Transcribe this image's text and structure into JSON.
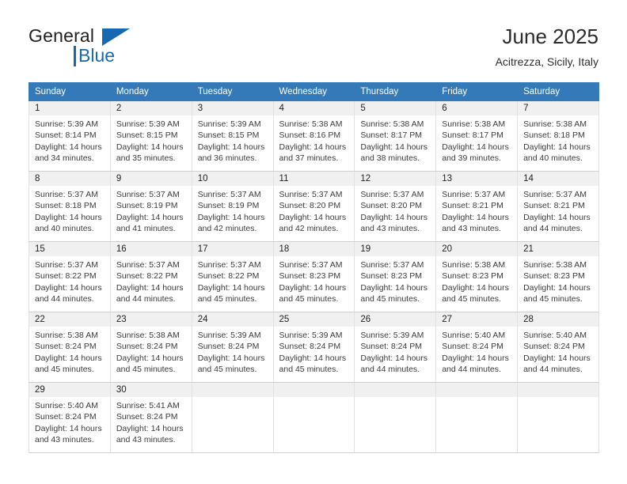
{
  "brand": {
    "name_dark": "General",
    "name_blue": "Blue",
    "accent_color": "#1668b3"
  },
  "header": {
    "title": "June 2025",
    "subtitle": "Acitrezza, Sicily, Italy"
  },
  "calendar": {
    "header_bg": "#3479b8",
    "daynum_bg": "#f0f0f0",
    "columns": [
      "Sunday",
      "Monday",
      "Tuesday",
      "Wednesday",
      "Thursday",
      "Friday",
      "Saturday"
    ],
    "weeks": [
      [
        {
          "day": "1",
          "sunrise": "Sunrise: 5:39 AM",
          "sunset": "Sunset: 8:14 PM",
          "daylight1": "Daylight: 14 hours",
          "daylight2": "and 34 minutes."
        },
        {
          "day": "2",
          "sunrise": "Sunrise: 5:39 AM",
          "sunset": "Sunset: 8:15 PM",
          "daylight1": "Daylight: 14 hours",
          "daylight2": "and 35 minutes."
        },
        {
          "day": "3",
          "sunrise": "Sunrise: 5:39 AM",
          "sunset": "Sunset: 8:15 PM",
          "daylight1": "Daylight: 14 hours",
          "daylight2": "and 36 minutes."
        },
        {
          "day": "4",
          "sunrise": "Sunrise: 5:38 AM",
          "sunset": "Sunset: 8:16 PM",
          "daylight1": "Daylight: 14 hours",
          "daylight2": "and 37 minutes."
        },
        {
          "day": "5",
          "sunrise": "Sunrise: 5:38 AM",
          "sunset": "Sunset: 8:17 PM",
          "daylight1": "Daylight: 14 hours",
          "daylight2": "and 38 minutes."
        },
        {
          "day": "6",
          "sunrise": "Sunrise: 5:38 AM",
          "sunset": "Sunset: 8:17 PM",
          "daylight1": "Daylight: 14 hours",
          "daylight2": "and 39 minutes."
        },
        {
          "day": "7",
          "sunrise": "Sunrise: 5:38 AM",
          "sunset": "Sunset: 8:18 PM",
          "daylight1": "Daylight: 14 hours",
          "daylight2": "and 40 minutes."
        }
      ],
      [
        {
          "day": "8",
          "sunrise": "Sunrise: 5:37 AM",
          "sunset": "Sunset: 8:18 PM",
          "daylight1": "Daylight: 14 hours",
          "daylight2": "and 40 minutes."
        },
        {
          "day": "9",
          "sunrise": "Sunrise: 5:37 AM",
          "sunset": "Sunset: 8:19 PM",
          "daylight1": "Daylight: 14 hours",
          "daylight2": "and 41 minutes."
        },
        {
          "day": "10",
          "sunrise": "Sunrise: 5:37 AM",
          "sunset": "Sunset: 8:19 PM",
          "daylight1": "Daylight: 14 hours",
          "daylight2": "and 42 minutes."
        },
        {
          "day": "11",
          "sunrise": "Sunrise: 5:37 AM",
          "sunset": "Sunset: 8:20 PM",
          "daylight1": "Daylight: 14 hours",
          "daylight2": "and 42 minutes."
        },
        {
          "day": "12",
          "sunrise": "Sunrise: 5:37 AM",
          "sunset": "Sunset: 8:20 PM",
          "daylight1": "Daylight: 14 hours",
          "daylight2": "and 43 minutes."
        },
        {
          "day": "13",
          "sunrise": "Sunrise: 5:37 AM",
          "sunset": "Sunset: 8:21 PM",
          "daylight1": "Daylight: 14 hours",
          "daylight2": "and 43 minutes."
        },
        {
          "day": "14",
          "sunrise": "Sunrise: 5:37 AM",
          "sunset": "Sunset: 8:21 PM",
          "daylight1": "Daylight: 14 hours",
          "daylight2": "and 44 minutes."
        }
      ],
      [
        {
          "day": "15",
          "sunrise": "Sunrise: 5:37 AM",
          "sunset": "Sunset: 8:22 PM",
          "daylight1": "Daylight: 14 hours",
          "daylight2": "and 44 minutes."
        },
        {
          "day": "16",
          "sunrise": "Sunrise: 5:37 AM",
          "sunset": "Sunset: 8:22 PM",
          "daylight1": "Daylight: 14 hours",
          "daylight2": "and 44 minutes."
        },
        {
          "day": "17",
          "sunrise": "Sunrise: 5:37 AM",
          "sunset": "Sunset: 8:22 PM",
          "daylight1": "Daylight: 14 hours",
          "daylight2": "and 45 minutes."
        },
        {
          "day": "18",
          "sunrise": "Sunrise: 5:37 AM",
          "sunset": "Sunset: 8:23 PM",
          "daylight1": "Daylight: 14 hours",
          "daylight2": "and 45 minutes."
        },
        {
          "day": "19",
          "sunrise": "Sunrise: 5:37 AM",
          "sunset": "Sunset: 8:23 PM",
          "daylight1": "Daylight: 14 hours",
          "daylight2": "and 45 minutes."
        },
        {
          "day": "20",
          "sunrise": "Sunrise: 5:38 AM",
          "sunset": "Sunset: 8:23 PM",
          "daylight1": "Daylight: 14 hours",
          "daylight2": "and 45 minutes."
        },
        {
          "day": "21",
          "sunrise": "Sunrise: 5:38 AM",
          "sunset": "Sunset: 8:23 PM",
          "daylight1": "Daylight: 14 hours",
          "daylight2": "and 45 minutes."
        }
      ],
      [
        {
          "day": "22",
          "sunrise": "Sunrise: 5:38 AM",
          "sunset": "Sunset: 8:24 PM",
          "daylight1": "Daylight: 14 hours",
          "daylight2": "and 45 minutes."
        },
        {
          "day": "23",
          "sunrise": "Sunrise: 5:38 AM",
          "sunset": "Sunset: 8:24 PM",
          "daylight1": "Daylight: 14 hours",
          "daylight2": "and 45 minutes."
        },
        {
          "day": "24",
          "sunrise": "Sunrise: 5:39 AM",
          "sunset": "Sunset: 8:24 PM",
          "daylight1": "Daylight: 14 hours",
          "daylight2": "and 45 minutes."
        },
        {
          "day": "25",
          "sunrise": "Sunrise: 5:39 AM",
          "sunset": "Sunset: 8:24 PM",
          "daylight1": "Daylight: 14 hours",
          "daylight2": "and 45 minutes."
        },
        {
          "day": "26",
          "sunrise": "Sunrise: 5:39 AM",
          "sunset": "Sunset: 8:24 PM",
          "daylight1": "Daylight: 14 hours",
          "daylight2": "and 44 minutes."
        },
        {
          "day": "27",
          "sunrise": "Sunrise: 5:40 AM",
          "sunset": "Sunset: 8:24 PM",
          "daylight1": "Daylight: 14 hours",
          "daylight2": "and 44 minutes."
        },
        {
          "day": "28",
          "sunrise": "Sunrise: 5:40 AM",
          "sunset": "Sunset: 8:24 PM",
          "daylight1": "Daylight: 14 hours",
          "daylight2": "and 44 minutes."
        }
      ],
      [
        {
          "day": "29",
          "sunrise": "Sunrise: 5:40 AM",
          "sunset": "Sunset: 8:24 PM",
          "daylight1": "Daylight: 14 hours",
          "daylight2": "and 43 minutes."
        },
        {
          "day": "30",
          "sunrise": "Sunrise: 5:41 AM",
          "sunset": "Sunset: 8:24 PM",
          "daylight1": "Daylight: 14 hours",
          "daylight2": "and 43 minutes."
        },
        {
          "day": "",
          "sunrise": "",
          "sunset": "",
          "daylight1": "",
          "daylight2": ""
        },
        {
          "day": "",
          "sunrise": "",
          "sunset": "",
          "daylight1": "",
          "daylight2": ""
        },
        {
          "day": "",
          "sunrise": "",
          "sunset": "",
          "daylight1": "",
          "daylight2": ""
        },
        {
          "day": "",
          "sunrise": "",
          "sunset": "",
          "daylight1": "",
          "daylight2": ""
        },
        {
          "day": "",
          "sunrise": "",
          "sunset": "",
          "daylight1": "",
          "daylight2": ""
        }
      ]
    ]
  }
}
